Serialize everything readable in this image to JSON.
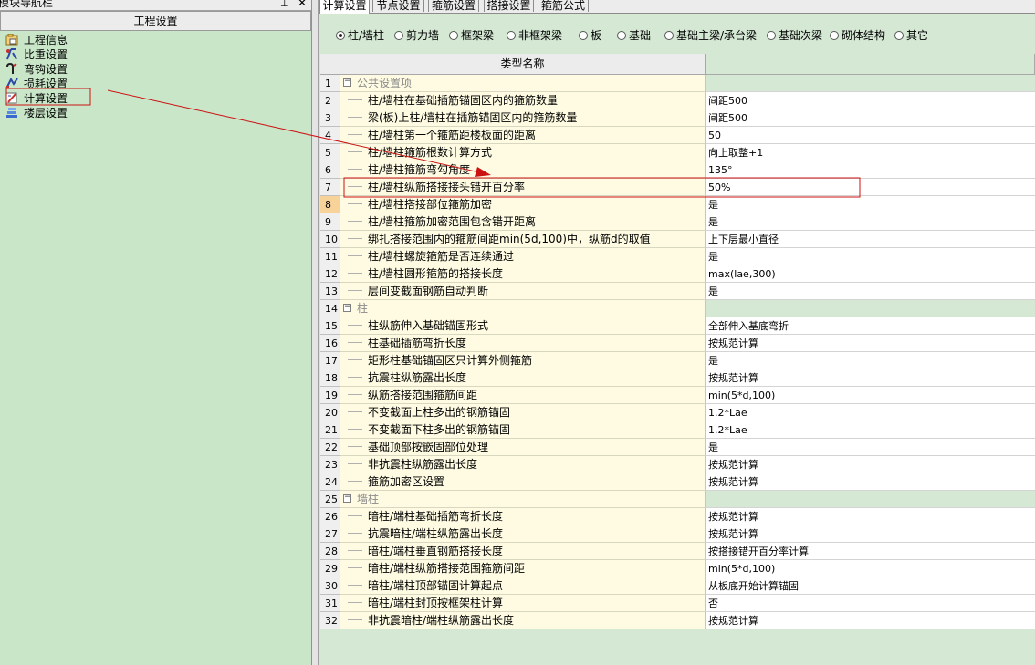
{
  "nav_panel": {
    "title": "模块导航栏",
    "section_button": "工程设置",
    "items": [
      {
        "label": "工程信息",
        "icon": "info-icon"
      },
      {
        "label": "比重设置",
        "icon": "weight-icon"
      },
      {
        "label": "弯钩设置",
        "icon": "hook-icon"
      },
      {
        "label": "损耗设置",
        "icon": "loss-icon"
      },
      {
        "label": "计算设置",
        "icon": "calc-icon"
      },
      {
        "label": "楼层设置",
        "icon": "floor-icon"
      }
    ]
  },
  "tabs": [
    {
      "label": "计算设置",
      "active": true
    },
    {
      "label": "节点设置",
      "active": false
    },
    {
      "label": "箍筋设置",
      "active": false
    },
    {
      "label": "搭接设置",
      "active": false
    },
    {
      "label": "箍筋公式",
      "active": false
    }
  ],
  "filter_options": [
    {
      "label": "柱/墙柱",
      "checked": true
    },
    {
      "label": "剪力墙",
      "checked": false
    },
    {
      "label": "框架梁",
      "checked": false
    },
    {
      "label": "非框架梁",
      "checked": false
    },
    {
      "label": "板",
      "checked": false
    },
    {
      "label": "基础",
      "checked": false
    },
    {
      "label": "基础主梁/承台梁",
      "checked": false
    },
    {
      "label": "基础次梁",
      "checked": false
    },
    {
      "label": "砌体结构",
      "checked": false
    },
    {
      "label": "其它",
      "checked": false
    }
  ],
  "grid": {
    "header": {
      "name": "类型名称",
      "value": ""
    },
    "rows": [
      {
        "no": "1",
        "group": true,
        "name": "公共设置项",
        "value": ""
      },
      {
        "no": "2",
        "name": "柱/墙柱在基础插筋锚固区内的箍筋数量",
        "value": "间距500"
      },
      {
        "no": "3",
        "name": "梁(板)上柱/墙柱在插筋锚固区内的箍筋数量",
        "value": "间距500"
      },
      {
        "no": "4",
        "name": "柱/墙柱第一个箍筋距楼板面的距离",
        "value": "50"
      },
      {
        "no": "5",
        "name": "柱/墙柱箍筋根数计算方式",
        "value": "向上取整+1"
      },
      {
        "no": "6",
        "name": "柱/墙柱箍筋弯勾角度",
        "value": "135°"
      },
      {
        "no": "7",
        "name": "柱/墙柱纵筋搭接接头错开百分率",
        "value": "50%"
      },
      {
        "no": "8",
        "name": "柱/墙柱搭接部位箍筋加密",
        "value": "是",
        "selected": true
      },
      {
        "no": "9",
        "name": "柱/墙柱箍筋加密范围包含错开距离",
        "value": "是"
      },
      {
        "no": "10",
        "name": "绑扎搭接范围内的箍筋间距min(5d,100)中，纵筋d的取值",
        "value": "上下层最小直径"
      },
      {
        "no": "11",
        "name": "柱/墙柱螺旋箍筋是否连续通过",
        "value": "是"
      },
      {
        "no": "12",
        "name": "柱/墙柱圆形箍筋的搭接长度",
        "value": "max(lae,300)"
      },
      {
        "no": "13",
        "name": "层间变截面钢筋自动判断",
        "value": "是"
      },
      {
        "no": "14",
        "group": true,
        "name": "柱",
        "value": ""
      },
      {
        "no": "15",
        "name": "柱纵筋伸入基础锚固形式",
        "value": "全部伸入基底弯折"
      },
      {
        "no": "16",
        "name": "柱基础插筋弯折长度",
        "value": "按规范计算"
      },
      {
        "no": "17",
        "name": "矩形柱基础锚固区只计算外侧箍筋",
        "value": "是"
      },
      {
        "no": "18",
        "name": "抗震柱纵筋露出长度",
        "value": "按规范计算"
      },
      {
        "no": "19",
        "name": "纵筋搭接范围箍筋间距",
        "value": "min(5*d,100)"
      },
      {
        "no": "20",
        "name": "不变截面上柱多出的钢筋锚固",
        "value": "1.2*Lae"
      },
      {
        "no": "21",
        "name": "不变截面下柱多出的钢筋锚固",
        "value": "1.2*Lae"
      },
      {
        "no": "22",
        "name": "基础顶部按嵌固部位处理",
        "value": "是"
      },
      {
        "no": "23",
        "name": "非抗震柱纵筋露出长度",
        "value": "按规范计算"
      },
      {
        "no": "24",
        "name": "箍筋加密区设置",
        "value": "按规范计算"
      },
      {
        "no": "25",
        "group": true,
        "name": "墙柱",
        "value": ""
      },
      {
        "no": "26",
        "name": "暗柱/端柱基础插筋弯折长度",
        "value": "按规范计算"
      },
      {
        "no": "27",
        "name": "抗震暗柱/端柱纵筋露出长度",
        "value": "按规范计算"
      },
      {
        "no": "28",
        "name": "暗柱/端柱垂直钢筋搭接长度",
        "value": "按搭接错开百分率计算"
      },
      {
        "no": "29",
        "name": "暗柱/端柱纵筋搭接范围箍筋间距",
        "value": "min(5*d,100)"
      },
      {
        "no": "30",
        "name": "暗柱/端柱顶部锚固计算起点",
        "value": "从板底开始计算锚固"
      },
      {
        "no": "31",
        "name": "暗柱/端柱封顶按框架柱计算",
        "value": "否"
      },
      {
        "no": "32",
        "name": "非抗震暗柱/端柱纵筋露出长度",
        "value": "按规范计算"
      }
    ]
  },
  "annotation_color": "#cc1111",
  "colors": {
    "panel_bg": "#c9e6c9",
    "name_cell_bg": "#fefbe2",
    "selected_row_number": "#f7d39a"
  }
}
